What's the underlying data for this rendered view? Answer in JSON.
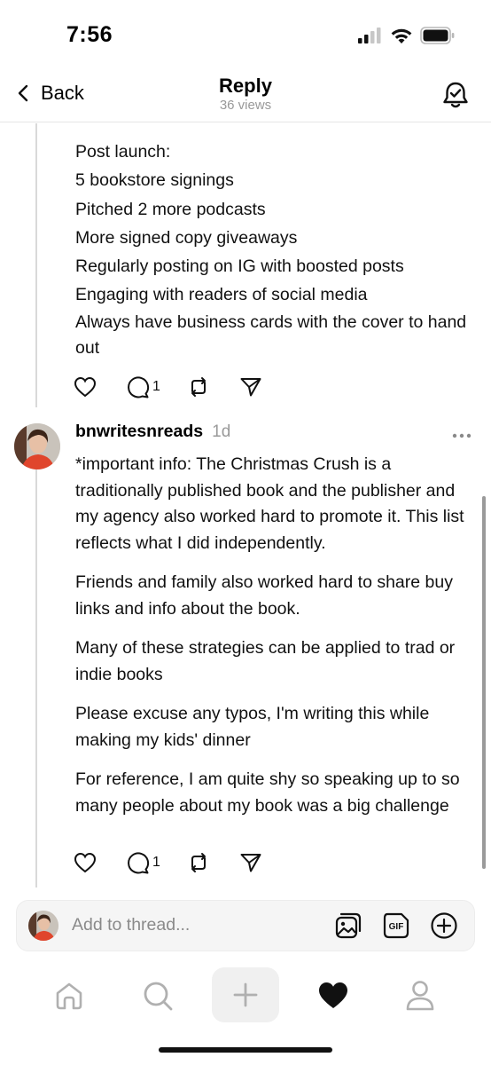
{
  "status_bar": {
    "time": "7:56"
  },
  "header": {
    "back_label": "Back",
    "title": "Reply",
    "views": "36 views"
  },
  "post1": {
    "lines": [
      "Post launch:",
      "5 bookstore signings",
      "Pitched 2 more podcasts",
      "More signed copy giveaways",
      "Regularly posting on IG with boosted posts",
      "Engaging with readers of social media",
      "Always have business cards with the cover to hand out"
    ],
    "reply_count": "1"
  },
  "post2": {
    "username": "bnwritesnreads",
    "timestamp": "1d",
    "paragraphs": [
      "*important info: The Christmas Crush is a traditionally published book and the publisher and my agency also worked hard to promote it. This list reflects what I did independently.",
      "Friends and family also worked hard to share buy links and info about the book.",
      "Many of these strategies can be applied to trad or indie books",
      "Please excuse any typos, I'm writing this while making my kids' dinner",
      "For reference, I am quite shy so speaking up to so many people about my book was a big challenge"
    ],
    "reply_count": "1"
  },
  "composer": {
    "placeholder": "Add to thread..."
  },
  "icons": {
    "status": [
      "signal-icon",
      "wifi-icon",
      "battery-icon"
    ],
    "header": [
      "chevron-left-icon",
      "bell-check-icon"
    ],
    "actions": [
      "heart-icon",
      "comment-icon",
      "repost-icon",
      "share-icon"
    ],
    "composer": [
      "image-icon",
      "gif-icon",
      "plus-circle-icon"
    ],
    "tabs": [
      "home-icon",
      "search-icon",
      "plus-icon",
      "heart-filled-icon",
      "profile-icon"
    ]
  }
}
